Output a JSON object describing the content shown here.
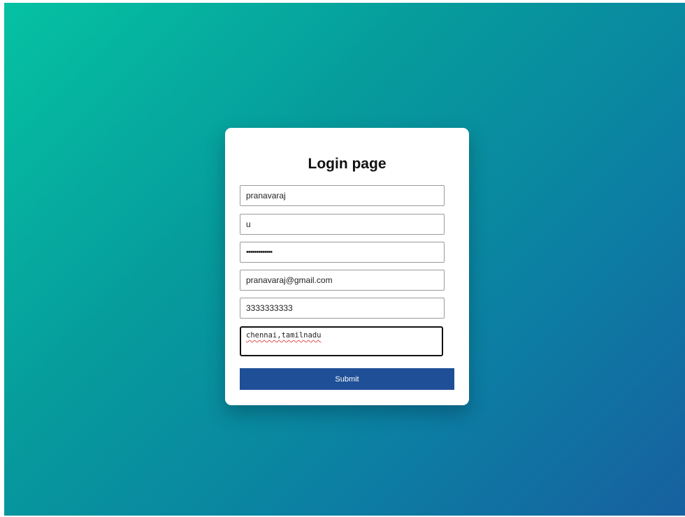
{
  "form": {
    "title": "Login page",
    "fields": {
      "username": "pranavaraj",
      "initial": "u",
      "password": "•••••••••••••",
      "email": "pranavaraj@gmail.com",
      "phone": "3333333333",
      "address": "chennai,tamilnadu"
    },
    "submit_label": "Submit"
  },
  "colors": {
    "gradient_start": "#05c2a2",
    "gradient_end": "#1760a0",
    "button": "#1f4f96"
  }
}
